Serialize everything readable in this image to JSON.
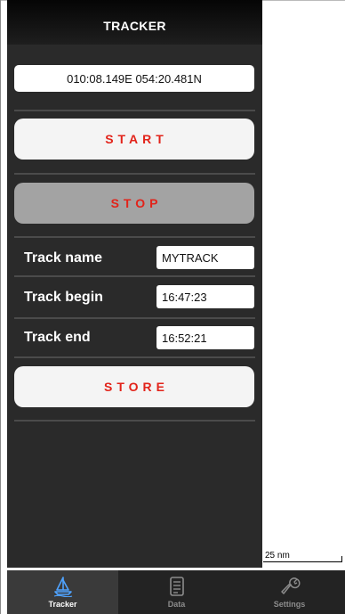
{
  "header": {
    "title": "TRACKER"
  },
  "position": {
    "text": "010:08.149E  054:20.481N"
  },
  "buttons": {
    "start": "START",
    "stop": "STOP",
    "store": "STORE"
  },
  "fields": {
    "track_name": {
      "label": "Track name",
      "value": "MYTRACK"
    },
    "track_begin": {
      "label": "Track begin",
      "value": "16:47:23"
    },
    "track_end": {
      "label": "Track end",
      "value": "16:52:21"
    }
  },
  "map": {
    "scale_label": "25 nm"
  },
  "tabs": [
    {
      "label": "Tracker",
      "icon": "sailboat-icon",
      "active": true
    },
    {
      "label": "Data",
      "icon": "document-icon",
      "active": false
    },
    {
      "label": "Settings",
      "icon": "wrench-icon",
      "active": false
    }
  ],
  "colors": {
    "panel": "#2a2a2a",
    "button_text": "#e2231a",
    "active_tab_text": "#ffffff",
    "inactive_tab_text": "#8c8c8c"
  }
}
